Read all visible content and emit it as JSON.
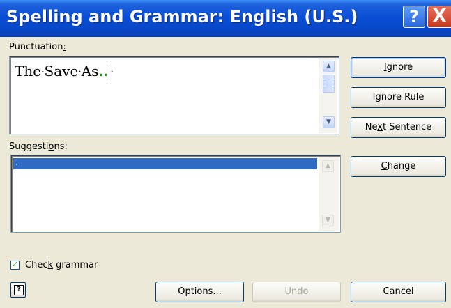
{
  "window": {
    "title": "Spelling and Grammar: English (U.S.)",
    "help_glyph": "?",
    "close_glyph": "X"
  },
  "punctuation": {
    "label_prefix": "Punctuation",
    "label_accel": ":",
    "words": [
      "The",
      "Save",
      "As"
    ],
    "separator": "·",
    "error_marks": "..",
    "trailing_mark": "·"
  },
  "suggestions": {
    "label_prefix": "Suggesti",
    "label_accel": "o",
    "label_suffix": "ns:",
    "items": [
      "."
    ]
  },
  "buttons": {
    "ignore": {
      "accel": "I",
      "rest": "gnore"
    },
    "ignore_rule": {
      "pre": "I",
      "accel": "g",
      "rest": "nore Rule"
    },
    "next_sentence": {
      "pre": "Ne",
      "accel": "x",
      "rest": "t Sentence"
    },
    "change": {
      "accel": "C",
      "rest": "hange"
    },
    "options": {
      "accel": "O",
      "rest": "ptions..."
    },
    "undo": "Undo",
    "cancel": "Cancel"
  },
  "check_grammar": {
    "checked": true,
    "check_glyph": "✓",
    "label_pre": "Chec",
    "label_accel": "k",
    "label_rest": " grammar"
  },
  "scrollbar_glyphs": {
    "up": "▲",
    "down": "▼"
  },
  "help_icon_glyph": "?",
  "colors": {
    "titlebar": "#0a4fd6",
    "dialog_bg": "#ece9d8",
    "selection": "#316ac5",
    "grammar_error": "#1a8c1a",
    "close_button": "#c6371d"
  }
}
